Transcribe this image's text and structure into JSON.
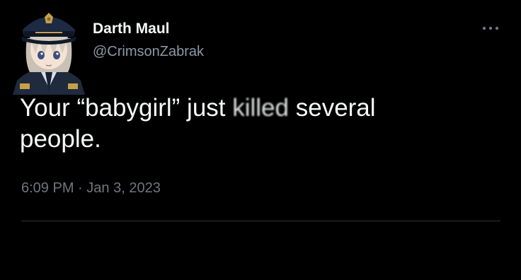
{
  "tweet": {
    "author": {
      "display_name": "Darth Maul",
      "handle": "@CrimsonZabrak",
      "avatar_icon": "anime-police-officer-avatar"
    },
    "text": {
      "line1_before": "Your “babygirl” just ",
      "smudged_word": "killed",
      "line1_after": " several",
      "line2": "people."
    },
    "timestamp": {
      "time": "6:09 PM",
      "separator": "·",
      "date": "Jan 3, 2023"
    },
    "more_icon": "more-options-icon"
  },
  "colors": {
    "background": "#000000",
    "primary_text": "#f7f9f9",
    "secondary_text": "#8b98a5",
    "meta_text": "#71767b",
    "divider": "#2f3336"
  }
}
